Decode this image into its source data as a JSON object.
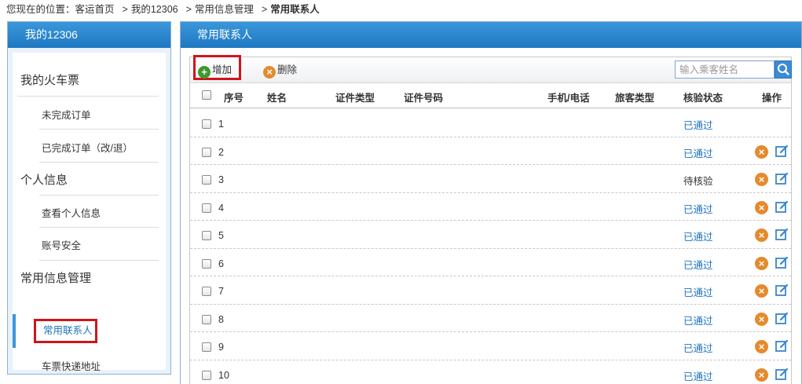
{
  "breadcrumb": {
    "prefix": "您现在的位置：",
    "items": [
      "客运首页",
      "我的12306",
      "常用信息管理",
      "常用联系人"
    ]
  },
  "sidebar": {
    "title": "我的12306",
    "groups": [
      {
        "label": "我的火车票",
        "items": [
          "未完成订单",
          "已完成订单（改/退）"
        ]
      },
      {
        "label": "个人信息",
        "items": [
          "查看个人信息",
          "账号安全"
        ]
      },
      {
        "label": "常用信息管理",
        "items": [
          "常用联系人",
          "车票快递地址"
        ]
      }
    ],
    "active_item": "常用联系人"
  },
  "main": {
    "title": "常用联系人",
    "toolbar": {
      "add_label": "增加",
      "delete_label": "删除"
    },
    "search": {
      "placeholder": "输入乘客姓名"
    },
    "columns": [
      "序号",
      "姓名",
      "证件类型",
      "证件号码",
      "手机/电话",
      "旅客类型",
      "核验状态",
      "操作"
    ],
    "rows": [
      {
        "index": "1",
        "status": "已通过",
        "actions": false
      },
      {
        "index": "2",
        "status": "已通过",
        "actions": true
      },
      {
        "index": "3",
        "status": "待核验",
        "actions": true
      },
      {
        "index": "4",
        "status": "已通过",
        "actions": true
      },
      {
        "index": "5",
        "status": "已通过",
        "actions": true
      },
      {
        "index": "6",
        "status": "已通过",
        "actions": true
      },
      {
        "index": "7",
        "status": "已通过",
        "actions": true
      },
      {
        "index": "8",
        "status": "已通过",
        "actions": true
      },
      {
        "index": "9",
        "status": "已通过",
        "actions": true
      },
      {
        "index": "10",
        "status": "已通过",
        "actions": true
      }
    ]
  },
  "colors": {
    "accent_blue": "#1e78c2",
    "link_blue": "#1c74bf",
    "highlight_red": "#d0141b",
    "add_green": "#3c9a2c",
    "delete_orange": "#e58a2e"
  },
  "icons": {
    "add": "plus-circle-icon",
    "delete": "x-circle-icon",
    "search": "search-icon",
    "edit": "edit-icon"
  }
}
